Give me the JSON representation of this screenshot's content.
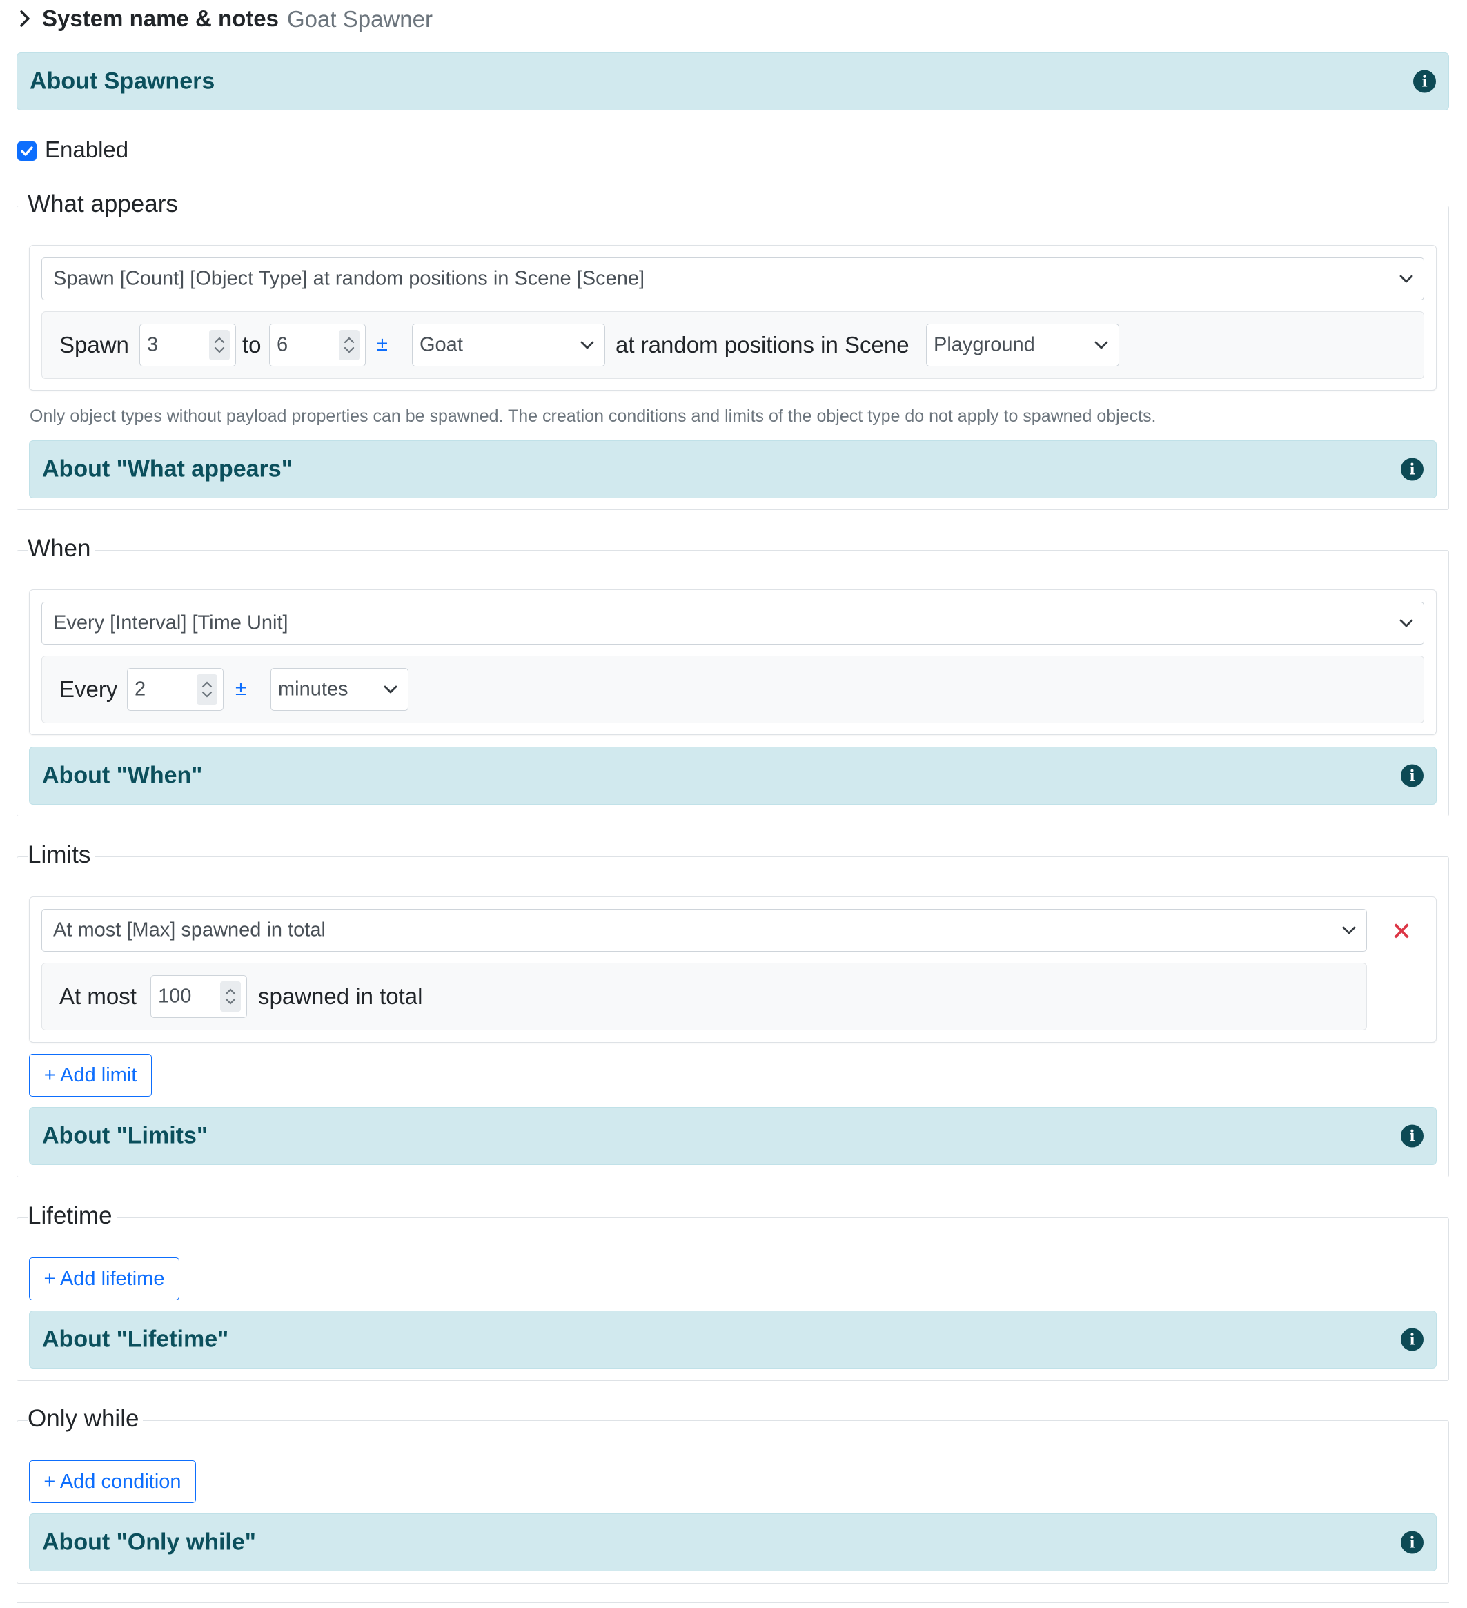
{
  "header": {
    "title": "System name & notes",
    "system_name": "Goat Spawner"
  },
  "about_spawners": "About Spawners",
  "enabled": {
    "label": "Enabled",
    "checked": true
  },
  "what_appears": {
    "legend": "What appears",
    "template_select": "Spawn [Count] [Object Type] at random positions in Scene [Scene]",
    "spawn_label": "Spawn",
    "count_min": "3",
    "to_label": "to",
    "count_max": "6",
    "pm_symbol": "±",
    "object_type": "Goat",
    "positions_label": "at random positions in Scene",
    "scene": "Playground",
    "help_text": "Only object types without payload properties can be spawned. The creation conditions and limits of the object type do not apply to spawned objects.",
    "about": "About \"What appears\""
  },
  "when": {
    "legend": "When",
    "template_select": "Every [Interval] [Time Unit]",
    "every_label": "Every",
    "interval": "2",
    "pm_symbol": "±",
    "time_unit": "minutes",
    "about": "About \"When\""
  },
  "limits": {
    "legend": "Limits",
    "template_select": "At most [Max] spawned in total",
    "at_most_label": "At most",
    "max": "100",
    "spawned_label": "spawned in total",
    "remove_symbol": "✕",
    "add_button": "+ Add limit",
    "about": "About \"Limits\""
  },
  "lifetime": {
    "legend": "Lifetime",
    "add_button": "+ Add lifetime",
    "about": "About \"Lifetime\""
  },
  "only_while": {
    "legend": "Only while",
    "add_button": "+ Add condition",
    "about": "About \"Only while\""
  },
  "icons": {
    "expand": "chevron-right-icon",
    "info": "info-circle-icon",
    "check": "checkmark-icon",
    "caret": "chevron-down-icon",
    "remove": "close-icon"
  },
  "colors": {
    "banner_bg": "#d1e9ee",
    "banner_text": "#0b4f5c",
    "primary": "#0d6efd",
    "danger": "#dc3545"
  }
}
